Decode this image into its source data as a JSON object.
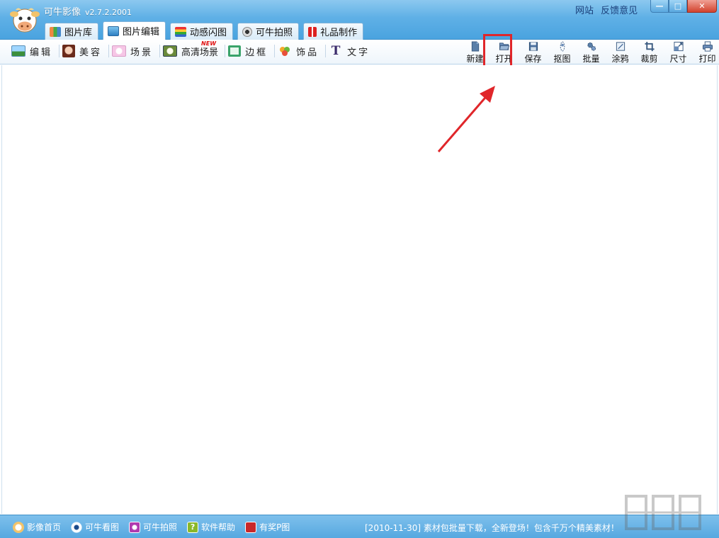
{
  "app": {
    "title": "可牛影像",
    "version": "v2.7.2.2001"
  },
  "top_links": {
    "website": "网站",
    "feedback": "反馈意见"
  },
  "window": {
    "minimize": "—",
    "maximize": "□",
    "close": "✕"
  },
  "tabs": [
    {
      "label": "图片库",
      "icon": "gallery-icon"
    },
    {
      "label": "图片编辑",
      "icon": "image-edit-icon"
    },
    {
      "label": "动感闪图",
      "icon": "animation-icon"
    },
    {
      "label": "可牛拍照",
      "icon": "camera-icon"
    },
    {
      "label": "礼品制作",
      "icon": "gift-icon"
    }
  ],
  "toolbar_left": [
    {
      "label": "编辑",
      "icon": "landscape-icon"
    },
    {
      "label": "美容",
      "icon": "face-icon"
    },
    {
      "label": "场景",
      "icon": "scene-icon"
    },
    {
      "label": "高清场景",
      "icon": "hd-scene-icon",
      "badge": "NEW"
    },
    {
      "label": "边框",
      "icon": "frame-icon"
    },
    {
      "label": "饰品",
      "icon": "clover-icon"
    },
    {
      "label": "文字",
      "icon": "text-icon"
    }
  ],
  "toolbar_right": [
    {
      "label": "新建",
      "icon": "new-file-icon"
    },
    {
      "label": "打开",
      "icon": "open-folder-icon"
    },
    {
      "label": "保存",
      "icon": "save-icon"
    },
    {
      "label": "抠图",
      "icon": "cutout-icon"
    },
    {
      "label": "批量",
      "icon": "batch-gear-icon"
    },
    {
      "label": "涂鸦",
      "icon": "doodle-icon"
    },
    {
      "label": "裁剪",
      "icon": "crop-icon"
    },
    {
      "label": "尺寸",
      "icon": "resize-icon"
    },
    {
      "label": "打印",
      "icon": "print-icon"
    }
  ],
  "status_links": [
    {
      "label": "影像首页",
      "icon": "cow-home-icon"
    },
    {
      "label": "可牛看图",
      "icon": "eye-icon"
    },
    {
      "label": "可牛拍照",
      "icon": "camera-icon"
    },
    {
      "label": "软件帮助",
      "icon": "help-icon"
    },
    {
      "label": "有奖P图",
      "icon": "prize-icon"
    }
  ],
  "news": "[2010-11-30] 素材包批量下载，全新登场！包含千万个精美素材！",
  "colors": {
    "accent": "#4aa3df",
    "highlight": "#e0262a"
  }
}
